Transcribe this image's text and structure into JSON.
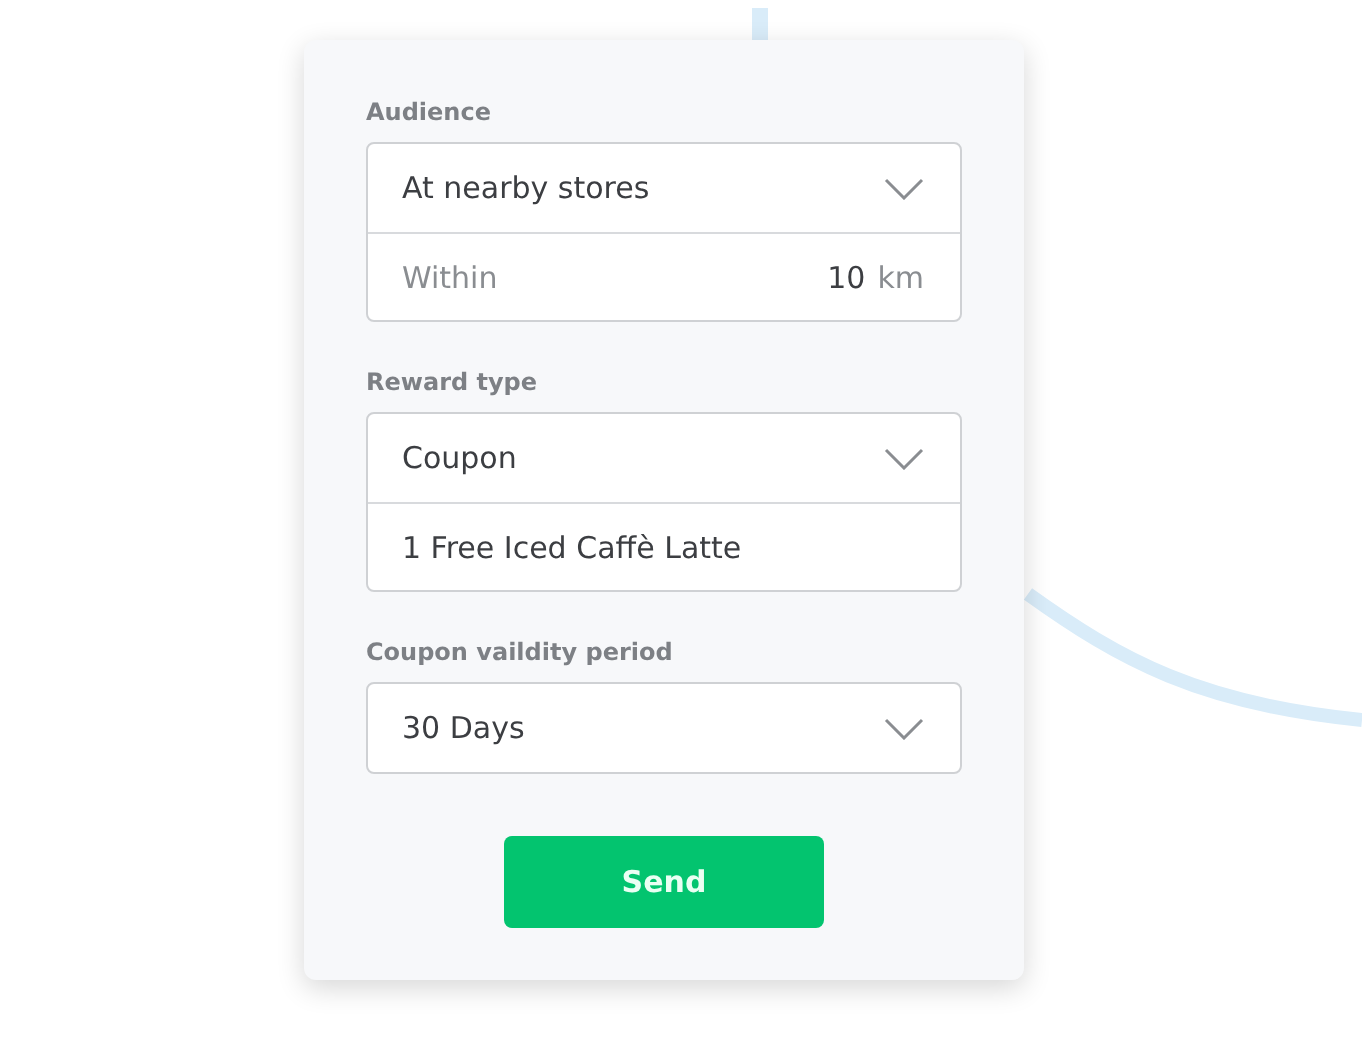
{
  "sections": [
    {
      "label": "Audience",
      "rows": [
        {
          "kind": "select",
          "value": "At nearby stores"
        },
        {
          "kind": "distance",
          "label": "Within",
          "value": "10",
          "unit": "km"
        }
      ]
    },
    {
      "label": "Reward type",
      "rows": [
        {
          "kind": "select",
          "value": "Coupon"
        },
        {
          "kind": "text",
          "value": "1 Free Iced Caffè Latte"
        }
      ]
    },
    {
      "label": "Coupon vaildity period",
      "rows": [
        {
          "kind": "select",
          "value": "30 Days"
        }
      ]
    }
  ],
  "button": "Send"
}
